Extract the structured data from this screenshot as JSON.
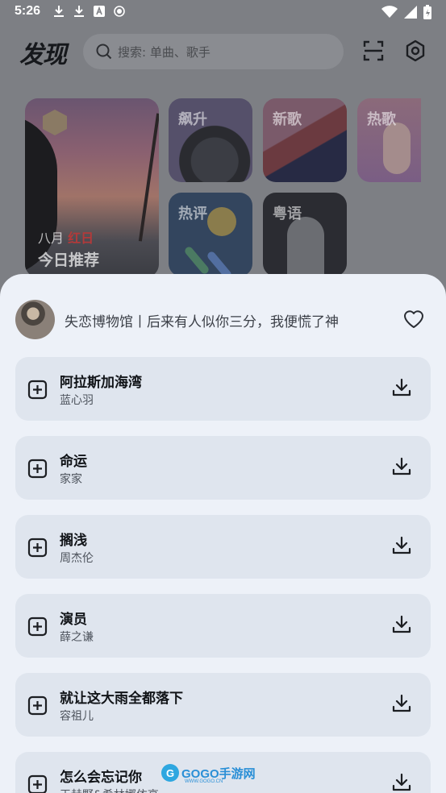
{
  "status_bar": {
    "time": "5:26",
    "left_icons": [
      "download-icon",
      "download-icon",
      "font-icon",
      "record-icon"
    ],
    "right_icons": [
      "wifi-icon",
      "signal-icon",
      "battery-charging-icon"
    ]
  },
  "header": {
    "logo": "发现",
    "search_placeholder": "搜索: 单曲、歌手",
    "icons": [
      "scan-icon",
      "settings-icon"
    ]
  },
  "discover_cards": {
    "daily": {
      "month": "八月",
      "month_highlight": "红日",
      "label": "今日推荐"
    },
    "surge": "飙升",
    "new_songs": "新歌",
    "hot_songs": "热歌",
    "hot_comments": "热评",
    "cantonese": "粤语"
  },
  "playlist": {
    "title": "失恋博物馆丨后来有人似你三分，我便慌了神"
  },
  "songs": [
    {
      "title": "阿拉斯加海湾",
      "artist": "蓝心羽"
    },
    {
      "title": "命运",
      "artist": "家家"
    },
    {
      "title": "搁浅",
      "artist": "周杰伦"
    },
    {
      "title": "演员",
      "artist": "薛之谦"
    },
    {
      "title": "就让这大雨全都落下",
      "artist": "容祖儿"
    },
    {
      "title": "怎么会忘记你",
      "artist": "王赫野&希林娜依高"
    }
  ],
  "watermark": {
    "brand": "GOGO手游网",
    "url": "WWW.GOGO.CN"
  },
  "colors": {
    "sheet_bg": "#edf1f8",
    "song_card_bg": "#dfe5ee",
    "scrim": "#7d7f84"
  }
}
